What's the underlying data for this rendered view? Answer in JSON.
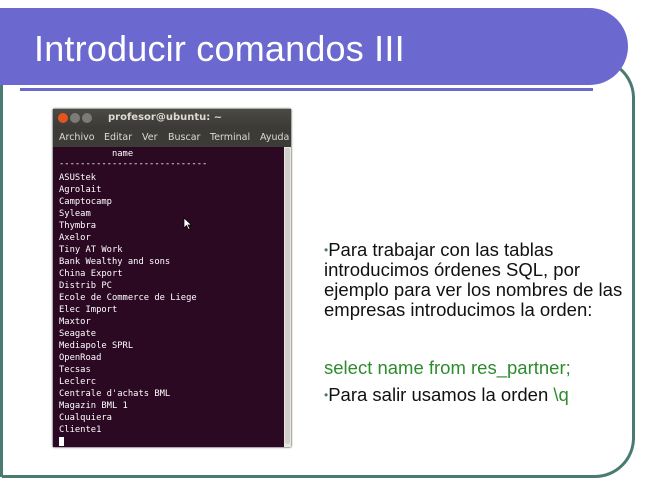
{
  "slide": {
    "title": "Introducir comandos III"
  },
  "terminal": {
    "title": "profesor@ubuntu: ~",
    "menu": [
      "Archivo",
      "Editar",
      "Ver",
      "Buscar",
      "Terminal",
      "Ayuda"
    ],
    "header": "          name",
    "separator": "----------------------------",
    "rows": [
      "ASUStek",
      "Agrolait",
      "Camptocamp",
      "Syleam",
      "Thymbra",
      "Axelor",
      "Tiny AT Work",
      "Bank Wealthy and sons",
      "China Export",
      "Distrib PC",
      "Ecole de Commerce de Liege",
      "Elec Import",
      "Maxtor",
      "Seagate",
      "Mediapole SPRL",
      "OpenRoad",
      "Tecsas",
      "Leclerc",
      "Centrale d'achats BML",
      "Magazin BML 1",
      "Cualquiera",
      "Cliente1"
    ],
    "prompt": ":"
  },
  "content": {
    "bullet1": "Para trabajar con las tablas introducimos órdenes SQL, por ejemplo para ver los nombres de las empresas introducimos la orden:",
    "sql": "select name from res_partner;",
    "bullet2_prefix": "Para salir usamos la orden ",
    "bullet2_code": "\\q"
  },
  "colors": {
    "title_bar": "#6b68cf",
    "outline": "#4a7b72",
    "terminal_bg": "#2c0922",
    "sql_green": "#2e8b2e"
  }
}
